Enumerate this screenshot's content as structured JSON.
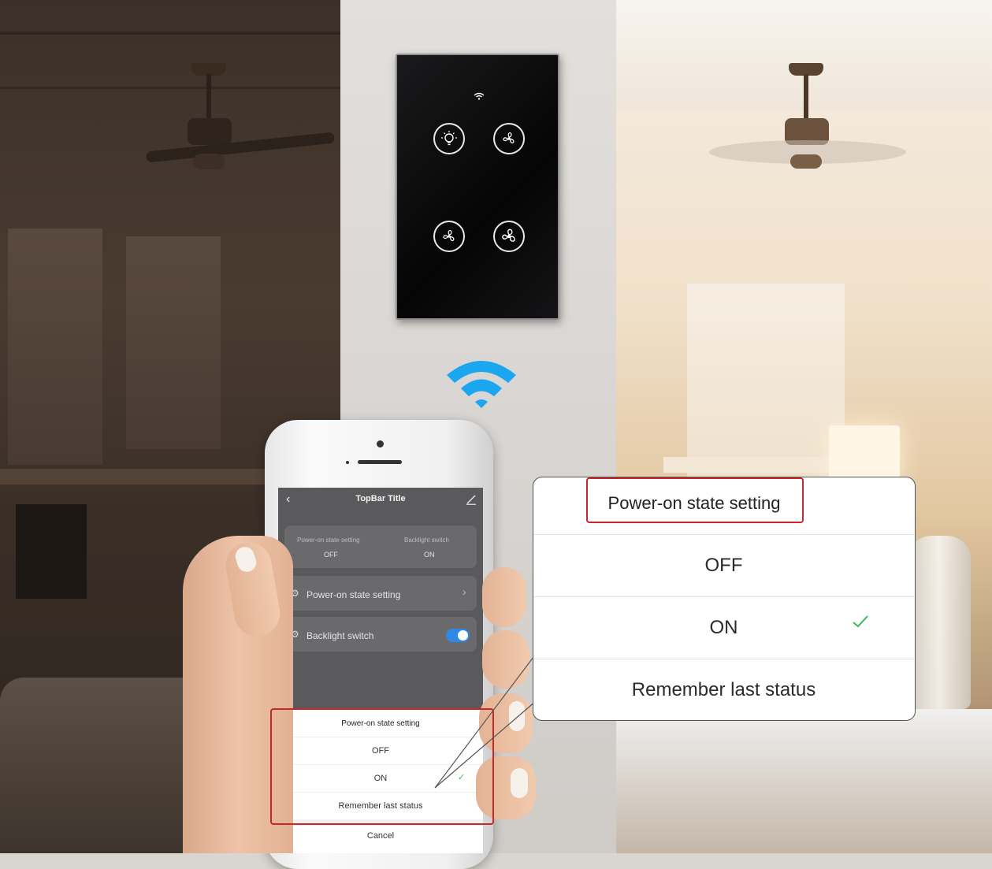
{
  "app": {
    "topbar_title": "TopBar Title",
    "summary": [
      {
        "label": "Power-on state setting",
        "value": "OFF"
      },
      {
        "label": "Backlight switch",
        "value": "ON"
      }
    ],
    "settings": [
      {
        "label": "Power-on state setting",
        "control": "chevron-right"
      },
      {
        "label": "Backlight switch",
        "control": "toggle-on"
      }
    ],
    "sheet": {
      "title": "Power-on state setting",
      "options": [
        "OFF",
        "ON",
        "Remember last status"
      ],
      "selected": "ON",
      "cancel_label": "Cancel"
    }
  },
  "callout": {
    "title": "Power-on state setting",
    "options": [
      "OFF",
      "ON",
      "Remember last status"
    ],
    "selected": "ON"
  },
  "colors": {
    "accent_red": "#c8262d",
    "check_green": "#3cb95a",
    "toggle_blue": "#2e88e6",
    "wifi_blue": "#1aa7f0"
  },
  "icons": {
    "switch_keys": [
      "bulb-icon",
      "fan-icon",
      "fan-icon",
      "fan-icon"
    ],
    "status": "wifi-icon"
  }
}
